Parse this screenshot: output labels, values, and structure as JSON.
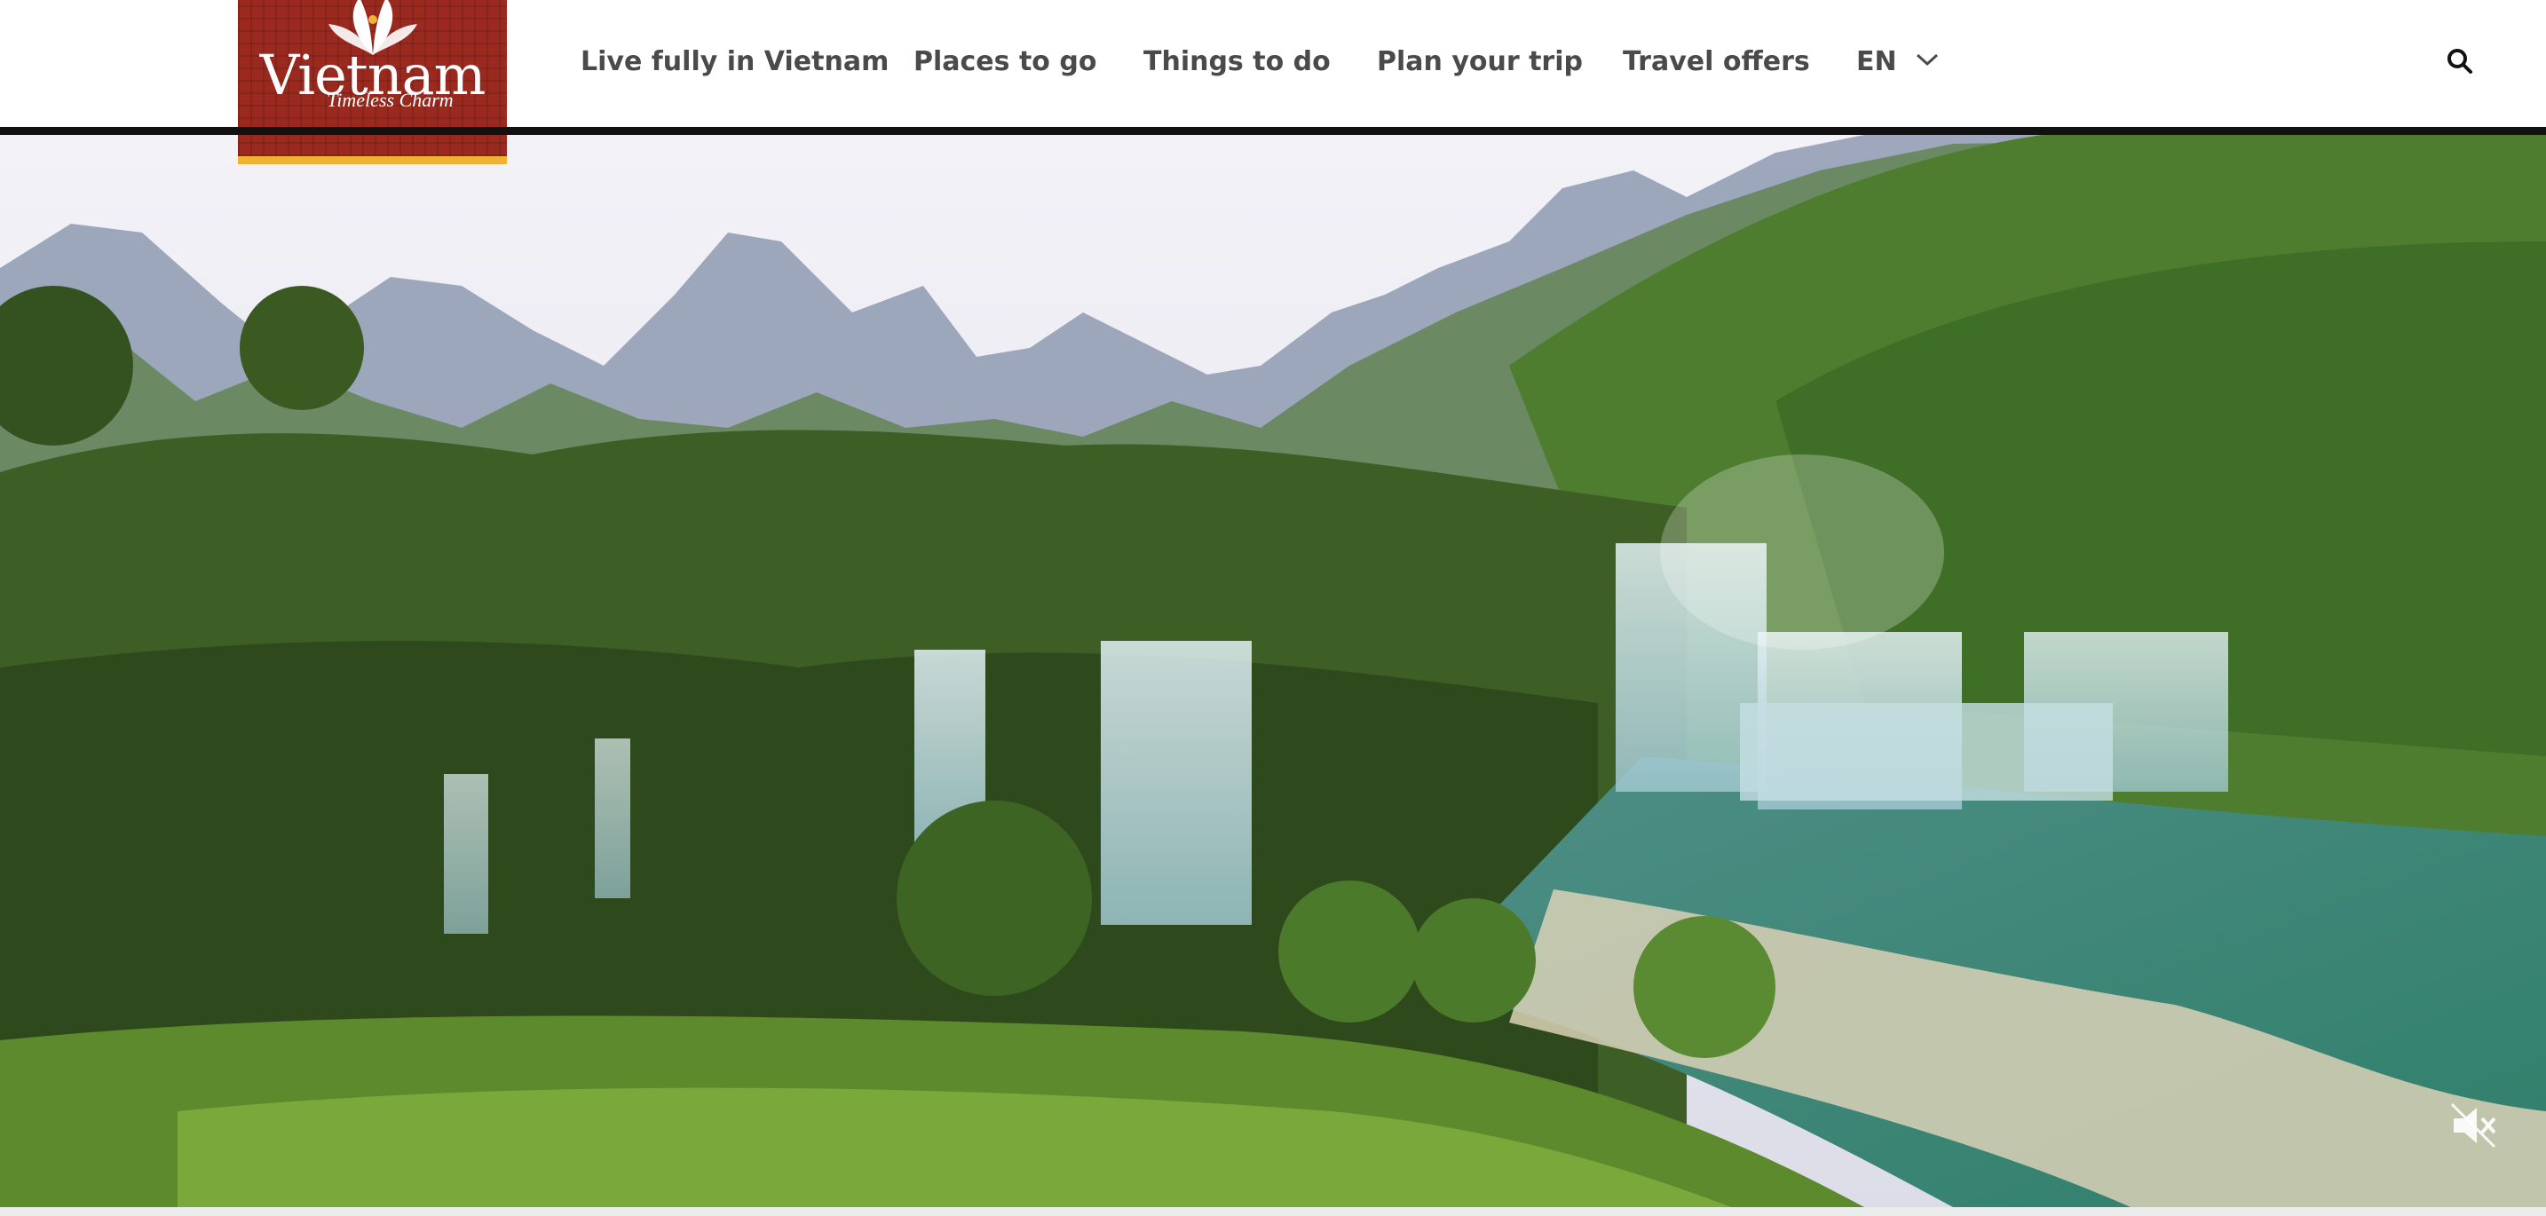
{
  "logo": {
    "title": "Vietnam",
    "tagline": "Timeless Charm",
    "brand_color": "#9a2a1f",
    "accent_color": "#f1b233"
  },
  "nav": {
    "items": [
      {
        "label": "Live fully in Vietnam"
      },
      {
        "label": "Places to go"
      },
      {
        "label": "Things to do"
      },
      {
        "label": "Plan your trip"
      },
      {
        "label": "Travel offers"
      }
    ],
    "language": "EN",
    "language_icon": "chevron-down-icon",
    "search_icon": "search-icon"
  },
  "hero": {
    "media": "video",
    "mute_icon": "volume-muted-icon"
  }
}
